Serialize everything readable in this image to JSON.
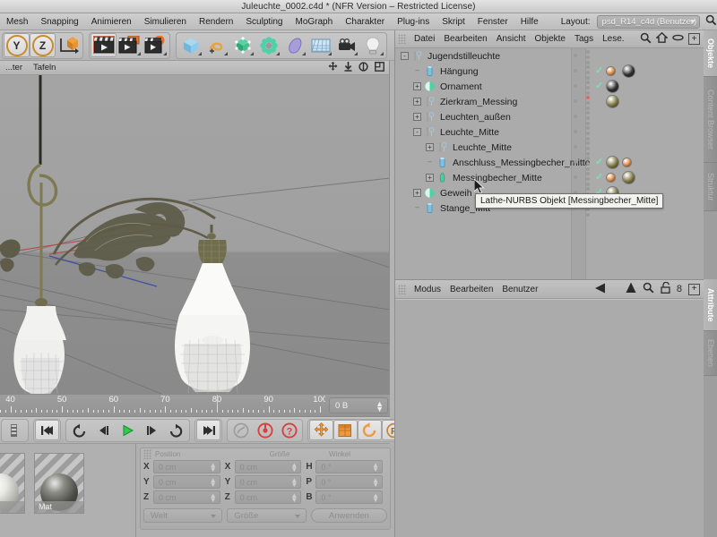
{
  "window": {
    "title": "Juleuchte_0002.c4d * (NFR Version – Restricted License)"
  },
  "main_menu": {
    "items": [
      {
        "label": "Mesh"
      },
      {
        "label": "Snapping"
      },
      {
        "label": "Animieren"
      },
      {
        "label": "Simulieren"
      },
      {
        "label": "Rendern"
      },
      {
        "label": "Sculpting"
      },
      {
        "label": "MoGraph"
      },
      {
        "label": "Charakter"
      },
      {
        "label": "Plug-ins"
      },
      {
        "label": "Skript"
      },
      {
        "label": "Fenster"
      },
      {
        "label": "Hilfe"
      }
    ],
    "layout_label": "Layout:",
    "layout_value": "psd_R14_c4d (Benutzer)",
    "search_icon": "search-icon"
  },
  "toolbar": {
    "axis_y": "Y",
    "axis_z": "Z",
    "buttons": [
      {
        "name": "axis-y-button",
        "label": "Y"
      },
      {
        "name": "axis-z-button",
        "label": "Z"
      },
      {
        "name": "object-axis-button",
        "label": ""
      },
      {
        "name": "make-editable-button",
        "label": ""
      },
      {
        "name": "render-view-button",
        "label": ""
      },
      {
        "name": "render-to-picture-viewer-button",
        "label": ""
      },
      {
        "name": "render-settings-button",
        "label": ""
      },
      {
        "name": "cube-primitive-button",
        "label": ""
      },
      {
        "name": "spline-button",
        "label": ""
      },
      {
        "name": "nurbs-button",
        "label": ""
      },
      {
        "name": "array-button",
        "label": ""
      },
      {
        "name": "deformer-button",
        "label": ""
      },
      {
        "name": "floor-environment-button",
        "label": ""
      },
      {
        "name": "camera-button",
        "label": ""
      },
      {
        "name": "light-button",
        "label": ""
      }
    ]
  },
  "viewport": {
    "menu": [
      {
        "label": "...ter"
      },
      {
        "label": "Tafeln"
      }
    ],
    "icons": [
      "move-view-icon",
      "dolly-view-icon",
      "rotate-view-icon",
      "maximize-view-icon"
    ]
  },
  "timeline": {
    "ticks": [
      40,
      50,
      60,
      70,
      80,
      90,
      100
    ],
    "start": 38,
    "end": 101,
    "frame_field_value": "0 B"
  },
  "transport": {
    "buttons": [
      {
        "name": "go-to-start-button",
        "glyph": "◀◀"
      },
      {
        "name": "previous-key-button",
        "glyph": "↺"
      },
      {
        "name": "step-back-button",
        "glyph": "◁"
      },
      {
        "name": "play-button",
        "glyph": "▷"
      },
      {
        "name": "step-forward-button",
        "glyph": "▷"
      },
      {
        "name": "next-key-button",
        "glyph": "↻"
      },
      {
        "name": "go-to-end-button",
        "glyph": "▶▶"
      },
      {
        "name": "autokey-link-button",
        "glyph": ""
      },
      {
        "name": "record-active-objects-button",
        "glyph": ""
      },
      {
        "name": "autokeying-button",
        "glyph": "?"
      },
      {
        "name": "record-position-button",
        "glyph": ""
      },
      {
        "name": "record-scale-button",
        "glyph": ""
      },
      {
        "name": "record-rotation-button",
        "glyph": ""
      },
      {
        "name": "record-parameter-button",
        "glyph": "P"
      },
      {
        "name": "record-pla-button",
        "glyph": ""
      },
      {
        "name": "keyframe-selection-button",
        "glyph": ""
      }
    ]
  },
  "material_manager": {
    "materials": [
      {
        "name": "",
        "label": "",
        "color": "#d9d9d6"
      },
      {
        "name": "Mat",
        "label": "Mat",
        "color": "#6d6d68"
      }
    ]
  },
  "coordinate_manager": {
    "menu": [
      {
        "label": "Modus"
      },
      {
        "label": "Bearbeiten"
      },
      {
        "label": "Benutzer"
      }
    ],
    "col_headers": [
      "Position",
      "Größe",
      "Winkel"
    ],
    "rows": [
      {
        "pos_axis": "X",
        "pos_value": "0 cm",
        "size_axis": "X",
        "size_value": "0 cm",
        "rot_axis": "H",
        "rot_value": "0 °"
      },
      {
        "pos_axis": "Y",
        "pos_value": "0 cm",
        "size_axis": "Y",
        "size_value": "0 cm",
        "rot_axis": "P",
        "rot_value": "0 °"
      },
      {
        "pos_axis": "Z",
        "pos_value": "0 cm",
        "size_axis": "Z",
        "size_value": "0 cm",
        "rot_axis": "B",
        "rot_value": "0 °"
      }
    ],
    "system_select": "Welt",
    "mode_select": "Größe",
    "apply_button": "Anwenden"
  },
  "object_manager": {
    "menu": [
      {
        "label": "Datei"
      },
      {
        "label": "Bearbeiten"
      },
      {
        "label": "Ansicht"
      },
      {
        "label": "Objekte"
      },
      {
        "label": "Tags"
      },
      {
        "label": "Lese."
      }
    ],
    "icons": [
      "search-icon",
      "home-icon",
      "ellipse-icon",
      "add-panel-icon"
    ],
    "tree": [
      {
        "label": "Jugendstilleuchte",
        "depth": 0,
        "expander": "-",
        "icon": "null-object-icon",
        "icon_color": "#b8b8b8",
        "visible_dots": true,
        "tags": []
      },
      {
        "label": "Hängung",
        "depth": 1,
        "expander": "",
        "icon": "polygon-object-icon",
        "icon_color": "#78c3e8",
        "check": true,
        "tags": [
          {
            "type": "texture-small",
            "color": "#e0893c"
          },
          {
            "type": "texture",
            "color": "#2b2b2b"
          }
        ]
      },
      {
        "label": "Ornament",
        "depth": 1,
        "expander": "+",
        "icon": "sweep-nurbs-icon",
        "icon_color": "#4cd2a6",
        "check": true,
        "tags": [
          {
            "type": "texture",
            "color": "#2b2b2b"
          }
        ]
      },
      {
        "label": "Zierkram_Messing",
        "depth": 1,
        "expander": "+",
        "icon": "null-object-icon",
        "icon_color": "#b8b8b8",
        "red": true,
        "tags": [
          {
            "type": "texture",
            "color": "#7d7540"
          }
        ]
      },
      {
        "label": "Leuchten_außen",
        "depth": 1,
        "expander": "+",
        "icon": "null-object-icon",
        "icon_color": "#b8b8b8",
        "tags": []
      },
      {
        "label": "Leuchte_Mitte",
        "depth": 1,
        "expander": "-",
        "icon": "null-object-icon",
        "icon_color": "#b8b8b8",
        "tags": []
      },
      {
        "label": "Leuchte_Mitte",
        "depth": 2,
        "expander": "+",
        "icon": "null-object-icon",
        "icon_color": "#b8b8b8",
        "tags": []
      },
      {
        "label": "Anschluss_Messingbecher_mitte",
        "depth": 2,
        "expander": "",
        "icon": "polygon-object-icon",
        "icon_color": "#78c3e8",
        "check": true,
        "tags": [
          {
            "type": "texture",
            "color": "#7d7540"
          },
          {
            "type": "texture-small",
            "color": "#e0893c"
          }
        ]
      },
      {
        "label": "Messingbecher_Mitte",
        "depth": 2,
        "expander": "+",
        "icon": "lathe-nurbs-icon",
        "icon_color": "#4cd2a6",
        "check": true,
        "tags": [
          {
            "type": "texture-small",
            "color": "#e0893c"
          },
          {
            "type": "texture",
            "color": "#7d7540"
          }
        ]
      },
      {
        "label": "Geweih",
        "depth": 1,
        "expander": "+",
        "icon": "sweep-nurbs-icon",
        "icon_color": "#4cd2a6",
        "check": true,
        "tags": [
          {
            "type": "texture",
            "color": "#7d7540"
          }
        ]
      },
      {
        "label": "Stange_Mitt",
        "depth": 1,
        "expander": "",
        "icon": "polygon-object-icon",
        "icon_color": "#78c3e8",
        "tags": []
      }
    ],
    "tooltip": "Lathe-NURBS Objekt [Messingbecher_Mitte]"
  },
  "attribute_manager": {
    "menu": [
      {
        "label": "Modus"
      },
      {
        "label": "Bearbeiten"
      },
      {
        "label": "Benutzer"
      }
    ],
    "icons": [
      "back-arrow-icon",
      "up-arrow-icon",
      "search-icon",
      "lock-icon",
      "pin-count-icon",
      "add-panel-icon"
    ],
    "pin_count": "8"
  },
  "tabs": {
    "top": [
      {
        "label": "Objekte",
        "active": true
      },
      {
        "label": "Content Browser",
        "active": false
      },
      {
        "label": "Struktur",
        "active": false
      }
    ],
    "bottom": [
      {
        "label": "Attribute",
        "active": true
      },
      {
        "label": "Ebenen",
        "active": false
      }
    ]
  },
  "colors": {
    "window_bg": "#b3b3b3",
    "panel_bg": "#ababab",
    "viewport_bg": "#9e9e9e",
    "accent_orange": "#c98a2e",
    "check_green": "#7fe0b6",
    "red_dot": "#e06666"
  }
}
